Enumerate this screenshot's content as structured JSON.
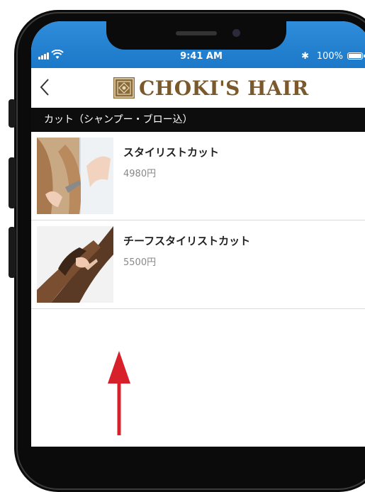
{
  "status_bar": {
    "time": "9:41 AM",
    "bluetooth_icon": "bluetooth-icon",
    "battery_pct": "100%"
  },
  "nav": {
    "back_icon": "chevron-left-icon",
    "logo_text": "CHOKI'S HAIR"
  },
  "section": {
    "title": "カット（シャンプー・ブロー込）"
  },
  "items": [
    {
      "name": "スタイリストカット",
      "price": "4980円"
    },
    {
      "name": "チーフスタイリストカット",
      "price": "5500円"
    }
  ],
  "colors": {
    "status_blue": "#1c78c8",
    "logo_brown": "#7a5a2c",
    "arrow_red": "#d8202a"
  }
}
